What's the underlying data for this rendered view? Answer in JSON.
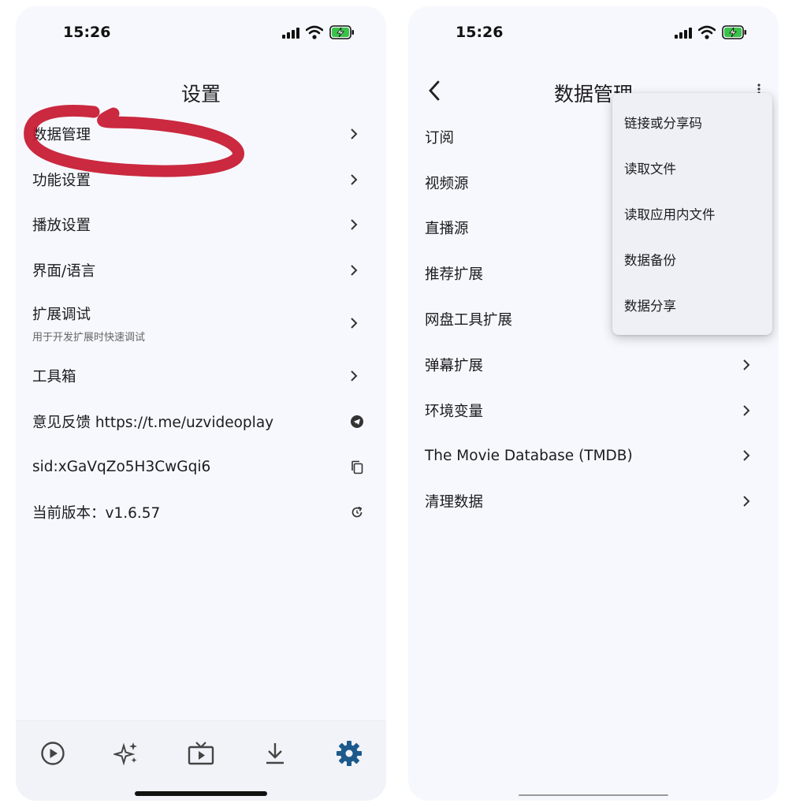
{
  "left_screen": {
    "status": {
      "time": "15:26"
    },
    "title": "设置",
    "rows": [
      {
        "label": "数据管理"
      },
      {
        "label": "功能设置"
      },
      {
        "label": "播放设置"
      },
      {
        "label": "界面/语言"
      },
      {
        "label": "扩展调试",
        "sub": "用于开发扩展时快速调试"
      },
      {
        "label": "工具箱"
      },
      {
        "label": "意见反馈 https://t.me/uzvideoplay",
        "icon": "telegram-icon"
      },
      {
        "label": "sid:xGaVqZo5H3CwGqi6",
        "icon": "copy-icon"
      },
      {
        "label": "当前版本：v1.6.57",
        "icon": "refresh-icon"
      }
    ],
    "bottom_nav": [
      {
        "icon": "play-circle-icon"
      },
      {
        "icon": "sparkle-icon"
      },
      {
        "icon": "tv-icon"
      },
      {
        "icon": "download-icon"
      },
      {
        "icon": "gear-icon",
        "active": true
      }
    ],
    "colors": {
      "active_nav": "#1c5a8c",
      "highlight_marker": "#c4122a"
    }
  },
  "right_screen": {
    "status": {
      "time": "15:26"
    },
    "title": "数据管理",
    "rows": [
      {
        "label": "订阅"
      },
      {
        "label": "视频源"
      },
      {
        "label": "直播源"
      },
      {
        "label": "推荐扩展"
      },
      {
        "label": "网盘工具扩展"
      },
      {
        "label": "弹幕扩展"
      },
      {
        "label": "环境变量"
      },
      {
        "label": "The Movie Database (TMDB)"
      },
      {
        "label": "清理数据"
      }
    ],
    "menu": [
      {
        "label": "链接或分享码"
      },
      {
        "label": "读取文件"
      },
      {
        "label": "读取应用内文件"
      },
      {
        "label": "数据备份"
      },
      {
        "label": "数据分享"
      }
    ]
  }
}
